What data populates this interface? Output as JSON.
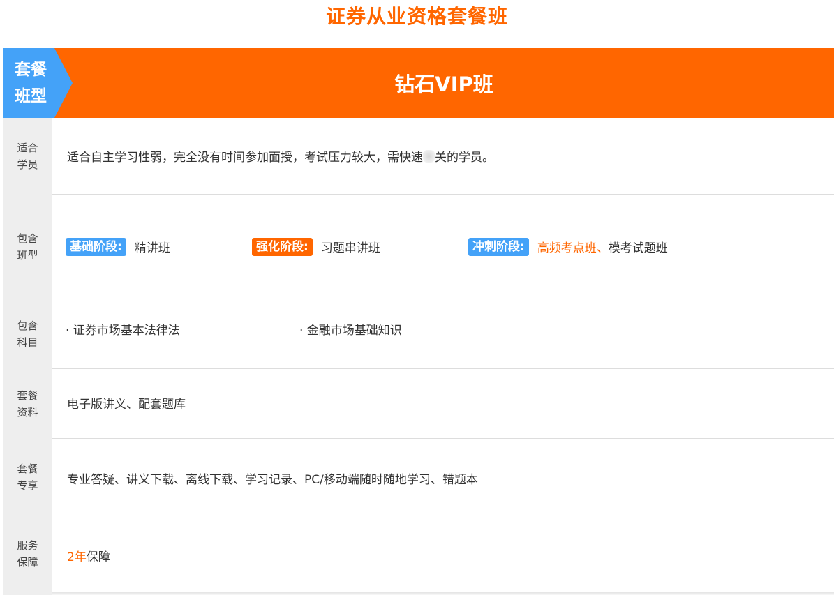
{
  "page_title": "证券从业资格套餐班",
  "header": {
    "type_tag_line1": "套餐",
    "type_tag_line2": "班型",
    "title": "钻石VIP班"
  },
  "rows": {
    "students": {
      "label_line1": "适合",
      "label_line2": "学员",
      "text_before": "适合自主学习性弱，完全没有时间参加面授，考试压力较大，需快速",
      "text_after": "关的学员。"
    },
    "classes": {
      "label_line1": "包含",
      "label_line2": "班型",
      "stages": [
        {
          "tag": "基础阶段:",
          "tag_color": "#44a2f8",
          "highlight": "",
          "text": "精讲班"
        },
        {
          "tag": "强化阶段:",
          "tag_color": "#ff6600",
          "highlight": "",
          "text": "习题串讲班"
        },
        {
          "tag": "冲刺阶段:",
          "tag_color": "#44a2f8",
          "highlight": "高频考点班、",
          "text": "模考试题班"
        }
      ]
    },
    "subjects": {
      "label_line1": "包含",
      "label_line2": "科目",
      "items": [
        "· 证券市场基本法律法",
        "· 金融市场基础知识"
      ]
    },
    "materials": {
      "label_line1": "套餐",
      "label_line2": "资料",
      "text": "电子版讲义、配套题库"
    },
    "benefits": {
      "label_line1": "套餐",
      "label_line2": "专享",
      "text": "专业答疑、讲义下载、离线下载、学习记录、PC/移动端随时随地学习、错题本"
    },
    "guarantee": {
      "label_line1": "服务",
      "label_line2": "保障",
      "highlight": "2年",
      "text": "保障"
    }
  },
  "colors": {
    "accent": "#ff6600",
    "blue": "#44a2f8"
  }
}
